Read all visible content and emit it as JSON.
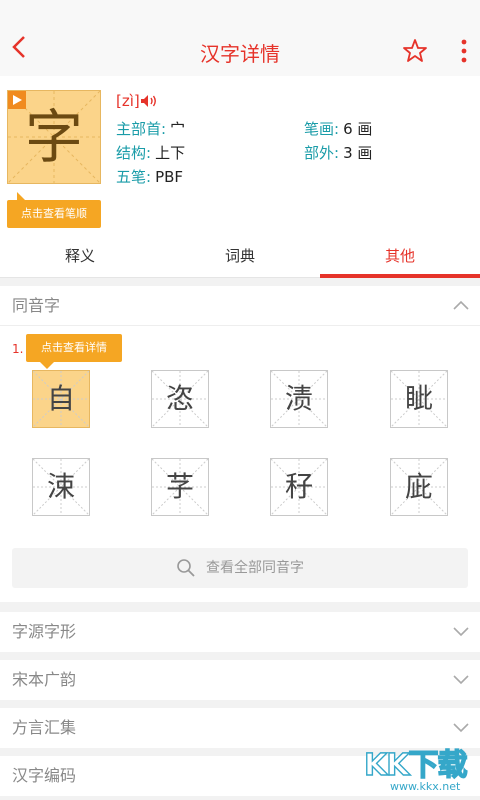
{
  "header": {
    "title": "汉字详情",
    "back_icon": "chevron-left-icon",
    "star_icon": "star-outline-icon",
    "more_icon": "vertical-dots-icon",
    "accent": "#e6332a"
  },
  "char": {
    "glyph": "字",
    "pinyin": "[zì]",
    "stroke_button": "点击查看笔顺",
    "radical_label": "主部首:",
    "radical_value": "宀",
    "strokes_label": "笔画:",
    "strokes_value": "6 画",
    "structure_label": "结构:",
    "structure_value": "上下",
    "outside_label": "部外:",
    "outside_value": "3 画",
    "wubi_label": "五笔:",
    "wubi_value": "PBF"
  },
  "tabs": [
    {
      "label": "释义",
      "active": false
    },
    {
      "label": "词典",
      "active": false
    },
    {
      "label": "其他",
      "active": true
    }
  ],
  "homophones": {
    "title": "同音字",
    "number_label": "1.",
    "tip": "点击查看详情",
    "chars": [
      "自",
      "恣",
      "渍",
      "眦",
      "涑",
      "芓",
      "秄",
      "庛"
    ],
    "view_all": "查看全部同音字"
  },
  "sections": [
    {
      "title": "字源字形"
    },
    {
      "title": "宋本广韵"
    },
    {
      "title": "方言汇集"
    },
    {
      "title": "汉字编码"
    }
  ],
  "watermark": {
    "big": "KK下载",
    "small": "www.kkx.net"
  }
}
